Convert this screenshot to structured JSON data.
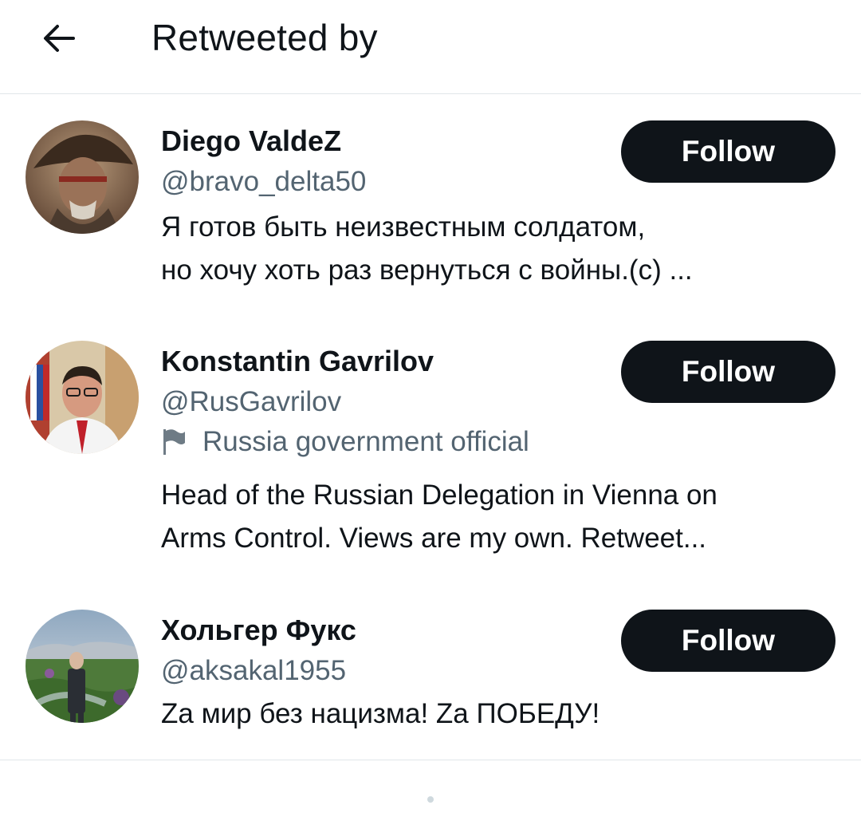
{
  "header": {
    "back_icon": "arrow-left-icon",
    "title": "Retweeted by"
  },
  "users": [
    {
      "name": "Diego ValdeZ",
      "handle": "@bravo_delta50",
      "follow_label": "Follow",
      "bio_lines": [
        "Я готов быть неизвестным солдатом,",
        "но хочу хоть раз вернуться с войны.(с) ..."
      ]
    },
    {
      "name": "Konstantin Gavrilov",
      "handle": "@RusGavrilov",
      "label": "Russia government official",
      "label_icon": "flag-icon",
      "follow_label": "Follow",
      "bio_lines": [
        "Head of the Russian Delegation in Vienna on",
        "Arms Control. Views are my own. Retweet..."
      ]
    },
    {
      "name": "Хольгер Фукс",
      "handle": "@aksakal1955",
      "follow_label": "Follow",
      "bio_lines": [
        "Zа мир без нацизма! Zа ПОБЕДУ!"
      ]
    }
  ],
  "colors": {
    "text": "#0f1419",
    "secondary": "#536471",
    "button_bg": "#0f1419",
    "button_text": "#ffffff",
    "divider": "#e1e6ea"
  }
}
